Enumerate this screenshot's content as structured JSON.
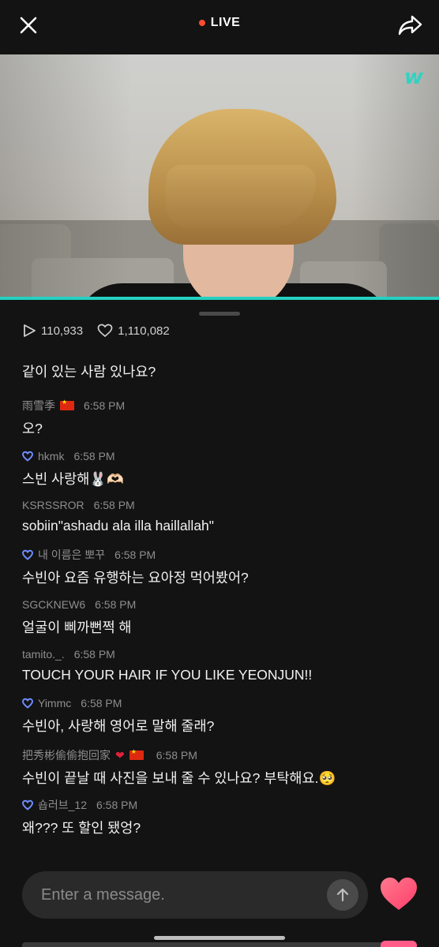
{
  "header": {
    "live_label": "LIVE",
    "close_icon": "close-icon",
    "share_icon": "share-icon",
    "accent_color": "#ff4d2e"
  },
  "video": {
    "logo_text": "w",
    "progress_color": "#25d0c0"
  },
  "stats": {
    "plays": "110,933",
    "likes": "1,110,082"
  },
  "chat": {
    "partial_top_text": "같이 있는 사람 있나요?",
    "messages": [
      {
        "name": "雨雪季",
        "flag": true,
        "badge": false,
        "time": "6:58 PM",
        "text": "오?"
      },
      {
        "name": "hkmk",
        "badge": true,
        "time": "6:58 PM",
        "text": "스빈 사랑해🐰🫶🏻"
      },
      {
        "name": "KSRSSROR",
        "badge": false,
        "time": "6:58 PM",
        "text": "sobiin\"ashadu ala illa haillallah\""
      },
      {
        "name": "내 이름은 뽀꾸",
        "badge": true,
        "time": "6:58 PM",
        "text": "수빈아 요즘 유행하는 요아정 먹어봤어?"
      },
      {
        "name": "SGCKNEW6",
        "badge": false,
        "time": "6:58 PM",
        "text": "얼굴이 삐까뻔쩍 해"
      },
      {
        "name": "tamito._.",
        "badge": false,
        "time": "6:58 PM",
        "text": "TOUCH YOUR HAIR IF YOU LIKE YEONJUN!!"
      },
      {
        "name": "Yimmc",
        "badge": true,
        "time": "6:58 PM",
        "text": "수빈아, 사랑해 영어로 말해 줄래?"
      },
      {
        "name": "把秀彬偷偷抱回家",
        "heart": true,
        "flag": true,
        "badge": false,
        "time": "6:58 PM",
        "text": "수빈이 끝날 때 사진을 보내 줄 수 있나요? 부탁해요.🥺"
      },
      {
        "name": "숍러브_12",
        "badge": true,
        "time": "6:58 PM",
        "text": "왜??? 또 할인 됐엉?"
      }
    ]
  },
  "input": {
    "placeholder": "Enter a message.",
    "send_icon": "arrow-up-icon",
    "heart_icon": "heart-icon",
    "heart_color": "#ff4d73"
  }
}
